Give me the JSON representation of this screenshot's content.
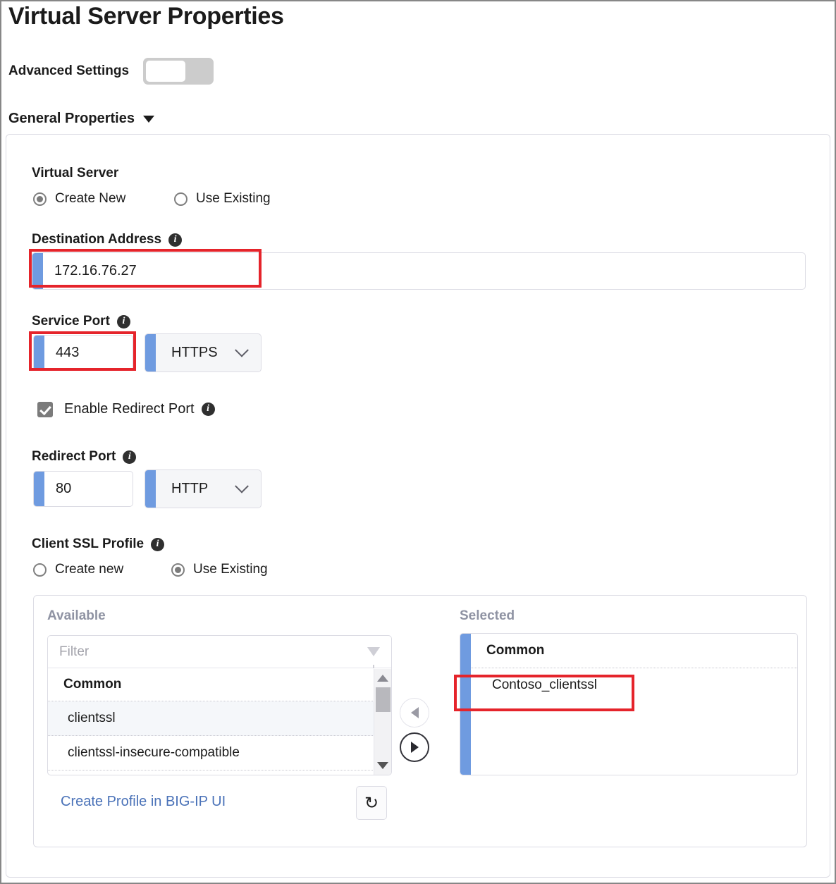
{
  "header": {
    "title": "Virtual Server Properties",
    "advanced_settings_label": "Advanced Settings",
    "advanced_settings_state": "off",
    "section_title": "General Properties"
  },
  "virtual_server": {
    "label": "Virtual Server",
    "options": [
      {
        "label": "Create New",
        "selected": true
      },
      {
        "label": "Use Existing",
        "selected": false
      }
    ]
  },
  "destination_address": {
    "label": "Destination Address",
    "value": "172.16.76.27",
    "highlighted": true
  },
  "service_port": {
    "label": "Service Port",
    "value": "443",
    "protocol": "HTTPS",
    "highlighted": true
  },
  "enable_redirect_port": {
    "label": "Enable Redirect Port",
    "checked": true
  },
  "redirect_port": {
    "label": "Redirect Port",
    "value": "80",
    "protocol": "HTTP"
  },
  "client_ssl_profile": {
    "label": "Client SSL Profile",
    "options": [
      {
        "label": "Create new",
        "selected": false
      },
      {
        "label": "Use Existing",
        "selected": true
      }
    ],
    "available": {
      "title": "Available",
      "filter_placeholder": "Filter",
      "filter_value": "",
      "group": "Common",
      "items": [
        {
          "label": "clientssl",
          "highlighted": true
        },
        {
          "label": "clientssl-insecure-compatible",
          "highlighted": false
        }
      ]
    },
    "transfer": {
      "move_left_label": "◀",
      "move_right_label": "▶",
      "move_left_enabled": false,
      "move_right_enabled": true
    },
    "selected": {
      "title": "Selected",
      "group": "Common",
      "items": [
        {
          "label": "Contoso_clientssl",
          "highlighted": true
        }
      ]
    },
    "create_profile_link": "Create Profile in BIG-IP UI",
    "refresh_icon_label": "↻"
  },
  "colors": {
    "accent_blue": "#6f9be0",
    "annotation_red": "#e5242b",
    "link_blue": "#4a72b8",
    "muted_label": "#8f93a3"
  }
}
